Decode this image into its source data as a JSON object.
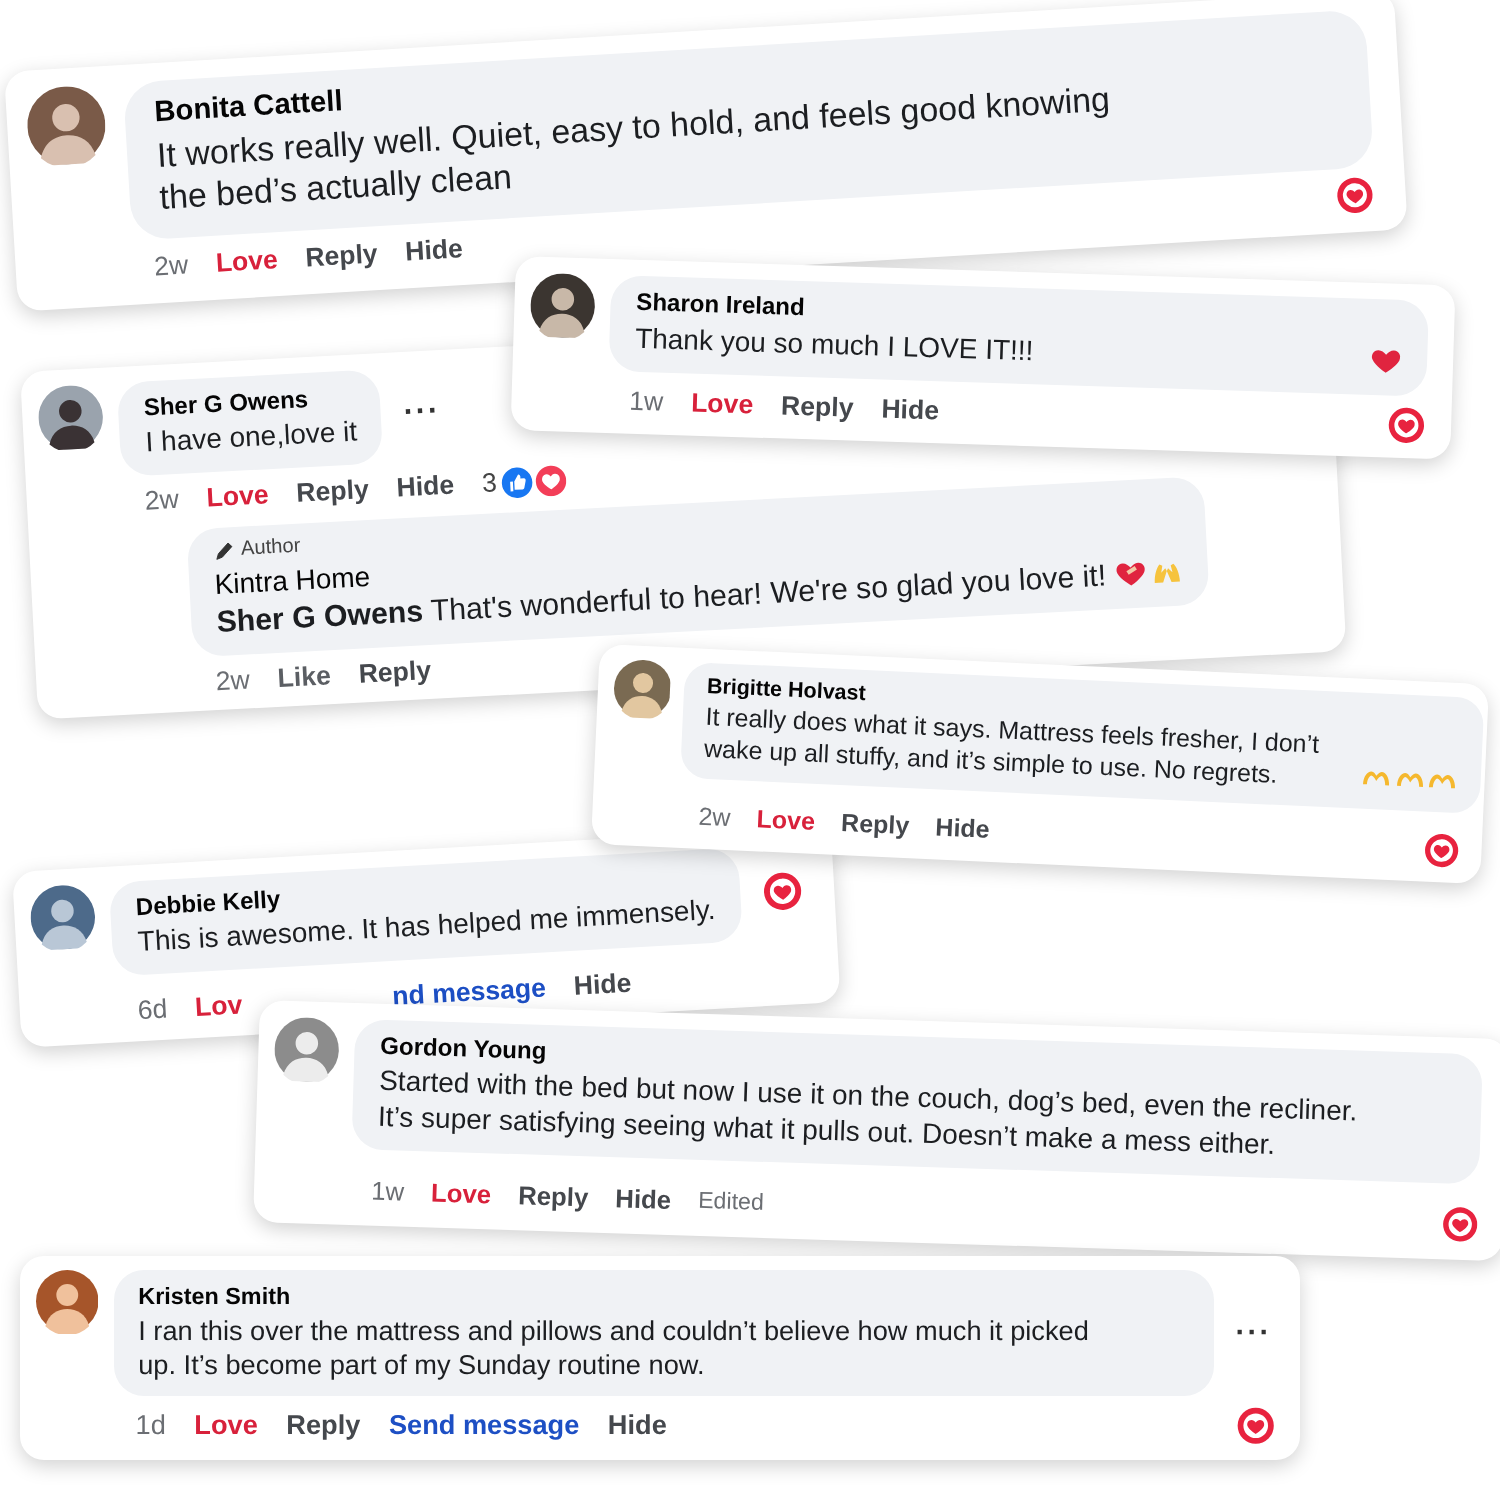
{
  "comments": [
    {
      "author": "Bonita Cattell",
      "text": "It works really well. Quiet, easy to hold, and feels good knowing the bed’s actually clean",
      "love_reaction": true,
      "actions": [
        {
          "label": "2w",
          "kind": "time"
        },
        {
          "label": "Love",
          "kind": "reaction",
          "selected": true
        },
        {
          "label": "Reply",
          "kind": "action"
        },
        {
          "label": "Hide",
          "kind": "action"
        }
      ]
    },
    {
      "author": "Sharon Ireland",
      "text": "Thank you so much I LOVE IT!!!",
      "love_reaction": true,
      "actions": [
        {
          "label": "1w",
          "kind": "time"
        },
        {
          "label": "Love",
          "kind": "reaction",
          "selected": true
        },
        {
          "label": "Reply",
          "kind": "action"
        },
        {
          "label": "Hide",
          "kind": "action"
        }
      ]
    },
    {
      "author": "Sher G Owens",
      "text": "I have one,love it",
      "more_menu": "···",
      "actions": [
        {
          "label": "2w",
          "kind": "time"
        },
        {
          "label": "Love",
          "kind": "reaction",
          "selected": true
        },
        {
          "label": "Reply",
          "kind": "action"
        },
        {
          "label": "Hide",
          "kind": "action"
        }
      ],
      "reaction_summary": {
        "count": "3"
      },
      "replies": [
        {
          "badge": "Author",
          "author": "Kintra Home",
          "text": "**Sher G Owens** That's wonderful to hear! We're so glad you love it!",
          "actions": [
            {
              "label": "2w",
              "kind": "time"
            },
            {
              "label": "Like",
              "kind": "reaction",
              "selected": false
            },
            {
              "label": "Reply",
              "kind": "action"
            }
          ]
        }
      ]
    },
    {
      "author": "Brigitte Holvast",
      "text": "It really does what it says. Mattress feels fresher, I don’t wake up all stuffy, and it’s simple to use. No regrets.",
      "love_reaction": true,
      "actions": [
        {
          "label": "2w",
          "kind": "time"
        },
        {
          "label": "Love",
          "kind": "reaction",
          "selected": true
        },
        {
          "label": "Reply",
          "kind": "action"
        },
        {
          "label": "Hide",
          "kind": "action"
        }
      ]
    },
    {
      "author": "Debbie Kelly",
      "text": "This is awesome. It has helped me immensely.",
      "love_reaction": true,
      "actions": [
        {
          "label": "6d",
          "kind": "time"
        },
        {
          "label": "Lov",
          "kind": "reaction",
          "selected": true
        },
        {
          "label": "nd message",
          "kind": "link"
        },
        {
          "label": "Hide",
          "kind": "action"
        }
      ]
    },
    {
      "author": "Gordon Young",
      "text": "Started with the bed but now I use it on the couch, dog’s bed, even the recliner. It’s super satisfying seeing what it pulls out. Doesn’t make a mess either.",
      "love_reaction": true,
      "actions": [
        {
          "label": "1w",
          "kind": "time"
        },
        {
          "label": "Love",
          "kind": "reaction",
          "selected": true
        },
        {
          "label": "Reply",
          "kind": "action"
        },
        {
          "label": "Hide",
          "kind": "action"
        },
        {
          "label": "Edited",
          "kind": "note"
        }
      ]
    },
    {
      "author": "Kristen Smith",
      "text": "I ran this over the mattress and pillows and couldn’t believe how much it picked up. It’s become part of my Sunday routine now.",
      "more_menu": "···",
      "love_reaction": true,
      "actions": [
        {
          "label": "1d",
          "kind": "time"
        },
        {
          "label": "Love",
          "kind": "reaction",
          "selected": true
        },
        {
          "label": "Reply",
          "kind": "action"
        },
        {
          "label": "Send message",
          "kind": "link"
        },
        {
          "label": "Hide",
          "kind": "action"
        }
      ]
    }
  ]
}
